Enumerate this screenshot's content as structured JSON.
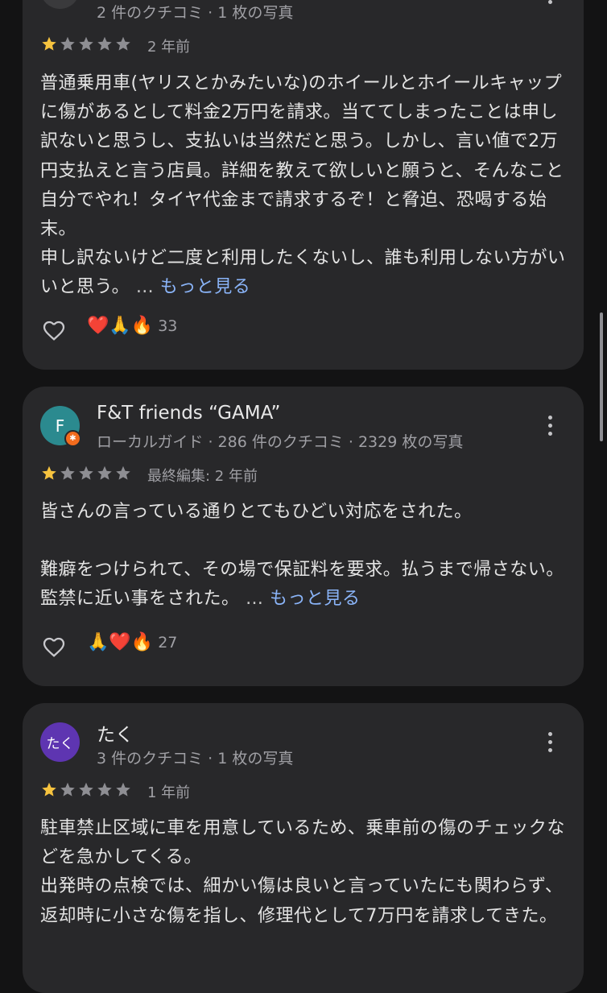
{
  "colors": {
    "background": "#131314",
    "card": "#28282a",
    "star_filled": "#f6c33f",
    "star_empty": "#8e8e93",
    "link": "#8ab4f8"
  },
  "reviews": [
    {
      "author": "",
      "meta": "2 件のクチコミ · 1 枚の写真",
      "rating": 1,
      "time": "2 年前",
      "paragraphs": [
        "普通乗用車(ヤリスとかみたいな)のホイールとホイールキャップに傷があるとして料金2万円を請求。当ててしまったことは申し訳ないと思うし、支払いは当然だと思う。しかし、言い値で2万円支払えと言う店員。詳細を教えて欲しいと願うと、そんなこと自分でやれ！タイヤ代金まで請求するぞ！と脅迫、恐喝する始末。",
        "申し訳ないけど二度と利用したくないし、誰も利用しない方がいいと思う。"
      ],
      "ellipsis": "…",
      "more": "もっと見る",
      "reactions": "❤️🙏🔥",
      "reaction_count": "33"
    },
    {
      "avatar_letter": "F",
      "avatar_color": "#2b8a8f",
      "author": "F&T friends “GAMA”",
      "meta": "ローカルガイド · 286 件のクチコミ · 2329 枚の写真",
      "rating": 1,
      "time": "最終編集: 2 年前",
      "paragraphs": [
        "皆さんの言っている通りとてもひどい対応をされた。",
        "",
        "難癖をつけられて、その場で保証料を要求。払うまで帰さない。監禁に近い事をされた。"
      ],
      "ellipsis": "…",
      "more": "もっと見る",
      "reactions": "🙏❤️🔥",
      "reaction_count": "27"
    },
    {
      "avatar_letter": "たく",
      "avatar_color": "#5e35b1",
      "author": "たく",
      "meta": "3 件のクチコミ · 1 枚の写真",
      "rating": 1,
      "time": "1 年前",
      "paragraphs": [
        "駐車禁止区域に車を用意しているため、乗車前の傷のチェックなどを急かしてくる。",
        "出発時の点検では、細かい傷は良いと言っていたにも関わらず、返却時に小さな傷を指し、修理代として7万円を請求してきた。"
      ]
    }
  ]
}
